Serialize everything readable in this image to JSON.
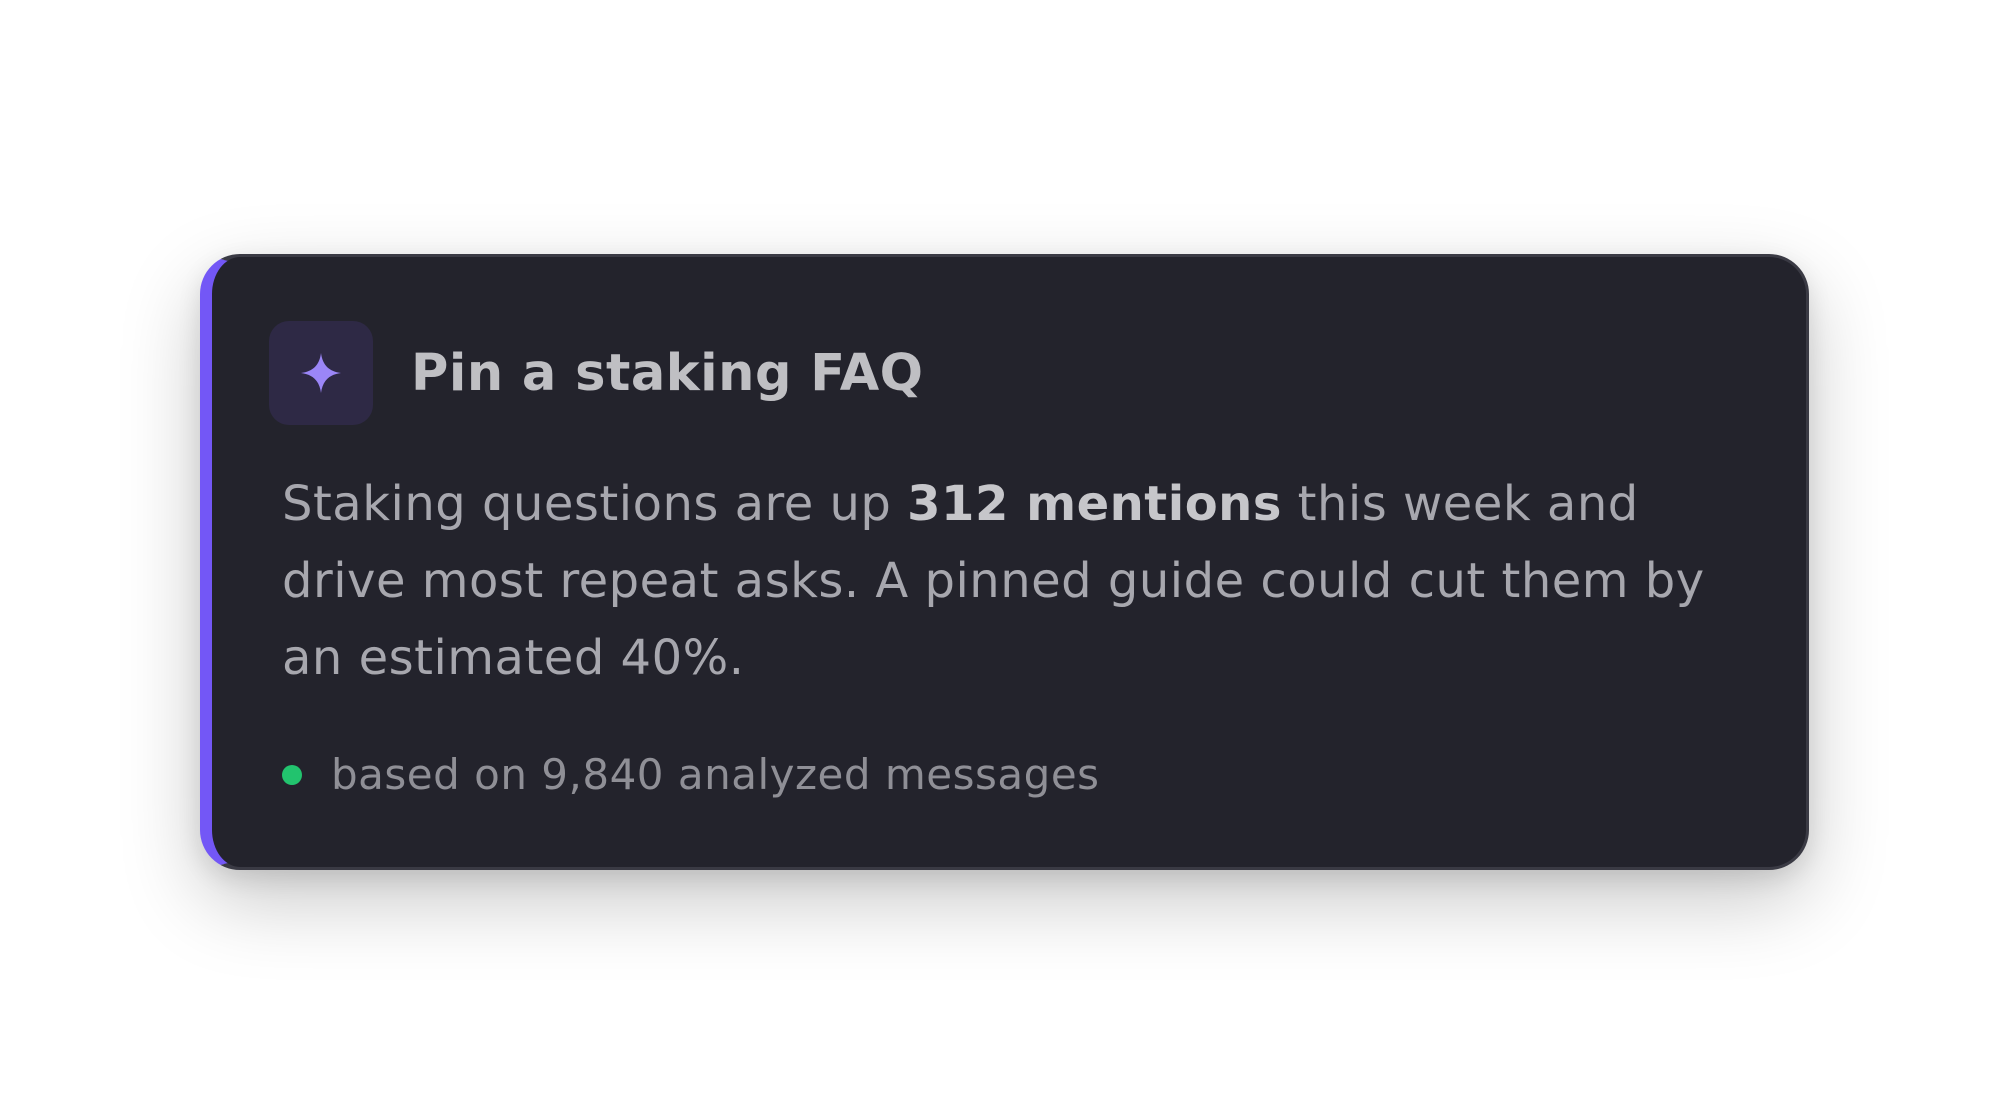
{
  "card": {
    "icon": "sparkle-icon",
    "title": "Pin a staking FAQ",
    "body": {
      "prefix": "Staking questions are up ",
      "highlight": "312 mentions",
      "suffix": " this week and drive most repeat asks. A pinned guide could cut them by an estimated 40%."
    },
    "footer": {
      "status_color": "#22c36e",
      "text": "based on 9,840 analyzed messages"
    }
  },
  "colors": {
    "accent": "#7357f6",
    "card_background": "#23232c",
    "icon_background": "#2e2945",
    "icon_color": "#9b86f7"
  }
}
